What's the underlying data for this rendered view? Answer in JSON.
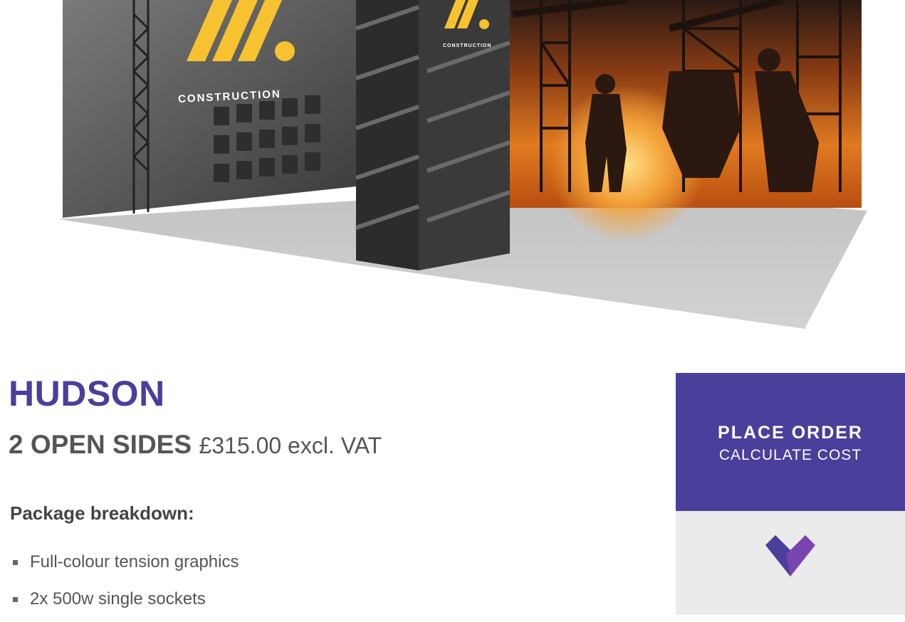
{
  "hero": {
    "left_logo_text": "CONSTRUCTION",
    "tower_logo_text": "CONSTRUCTION"
  },
  "product": {
    "title": "HUDSON",
    "sides": "2 OPEN SIDES",
    "price": "£315.00 excl. VAT"
  },
  "breakdown": {
    "heading": "Package breakdown:",
    "items": [
      "Full-colour tension graphics",
      "2x 500w single sockets"
    ]
  },
  "order": {
    "main_label": "PLACE ORDER",
    "sub_label": "CALCULATE COST",
    "expand_icon": "chevron-down-icon"
  },
  "colors": {
    "brand_purple": "#4a3f9b",
    "logo_yellow": "#f6c230",
    "expand_bg": "#ebebeb"
  }
}
